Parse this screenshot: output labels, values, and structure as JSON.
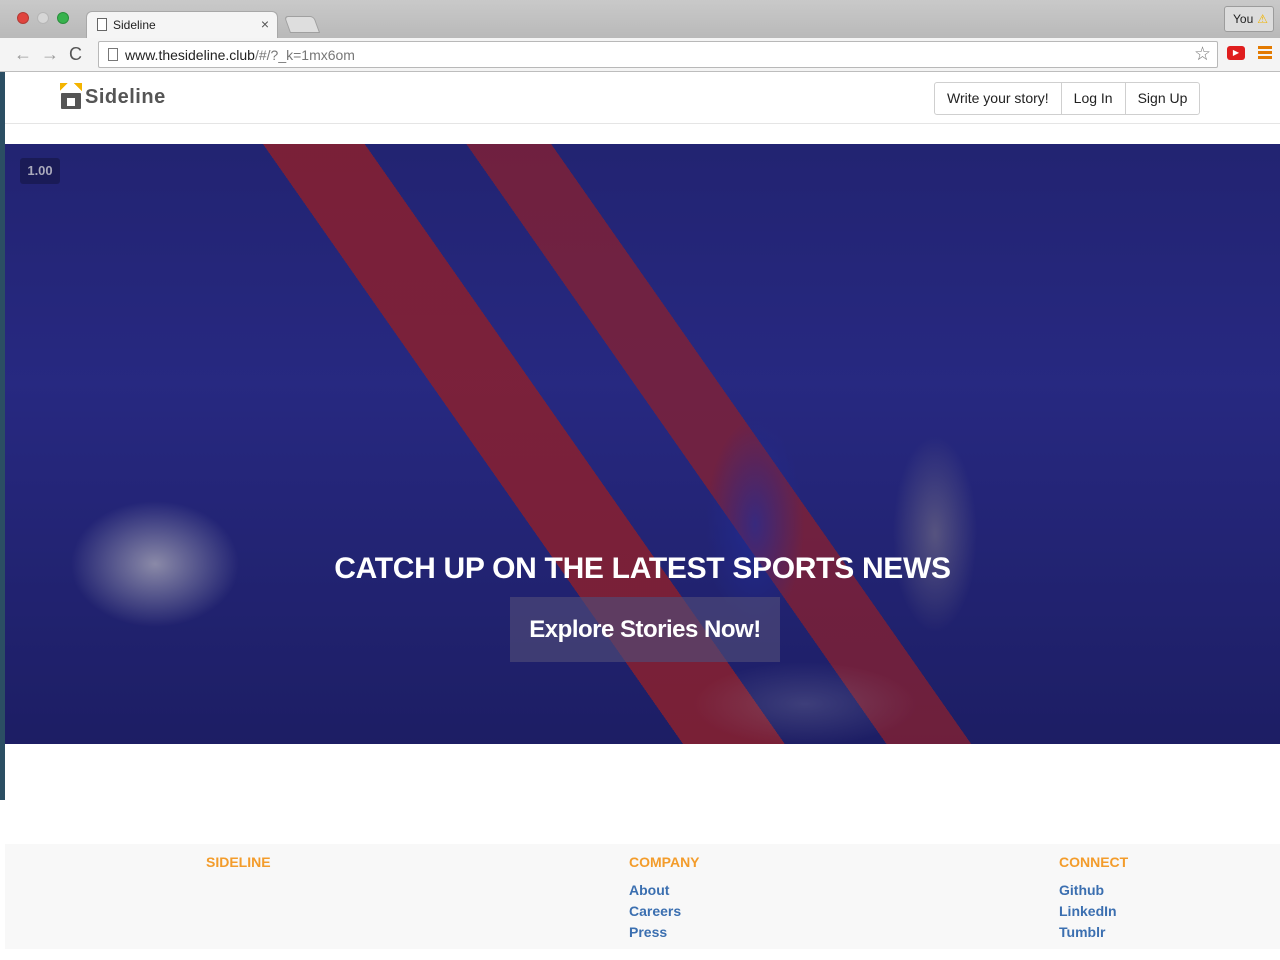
{
  "browser": {
    "tab_title": "Sideline",
    "tab_close": "×",
    "profile_label": "You",
    "profile_warning": "⚠",
    "url_host": "www.thesideline.club",
    "url_path": "/#/?_k=1mx6om",
    "back": "←",
    "forward": "→",
    "reload": "C",
    "star": "☆"
  },
  "header": {
    "logo_text": "Sideline",
    "nav": [
      "Write your story!",
      "Log In",
      "Sign Up"
    ]
  },
  "hero": {
    "speed_badge": "1.00",
    "title": "CATCH UP ON THE LATEST SPORTS NEWS",
    "cta": "Explore Stories Now!"
  },
  "footer": {
    "sideline": {
      "heading": "SIDELINE"
    },
    "company": {
      "heading": "COMPANY",
      "links": [
        "About",
        "Careers",
        "Press"
      ]
    },
    "connect": {
      "heading": "CONNECT",
      "links": [
        "Github",
        "LinkedIn",
        "Tumblr"
      ]
    }
  },
  "colors": {
    "footer_heading": "#f39c2b",
    "footer_link": "#3b6fb0",
    "logo_crown": "#f4b400"
  }
}
